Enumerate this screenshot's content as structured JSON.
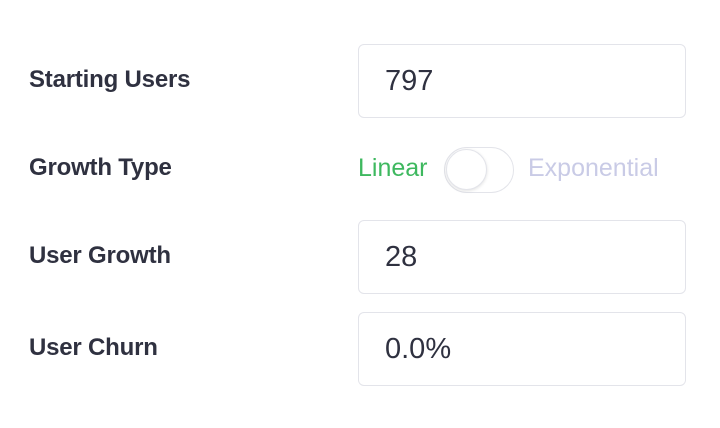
{
  "fields": {
    "starting_users": {
      "label": "Starting Users",
      "value": "797"
    },
    "growth_type": {
      "label": "Growth Type",
      "option_left": "Linear",
      "option_right": "Exponential",
      "selected": "Linear",
      "active_color": "#3eb85f",
      "inactive_color": "#c9cbe6"
    },
    "user_growth": {
      "label": "User Growth",
      "value": "28"
    },
    "user_churn": {
      "label": "User Churn",
      "value": "0.0%"
    }
  }
}
